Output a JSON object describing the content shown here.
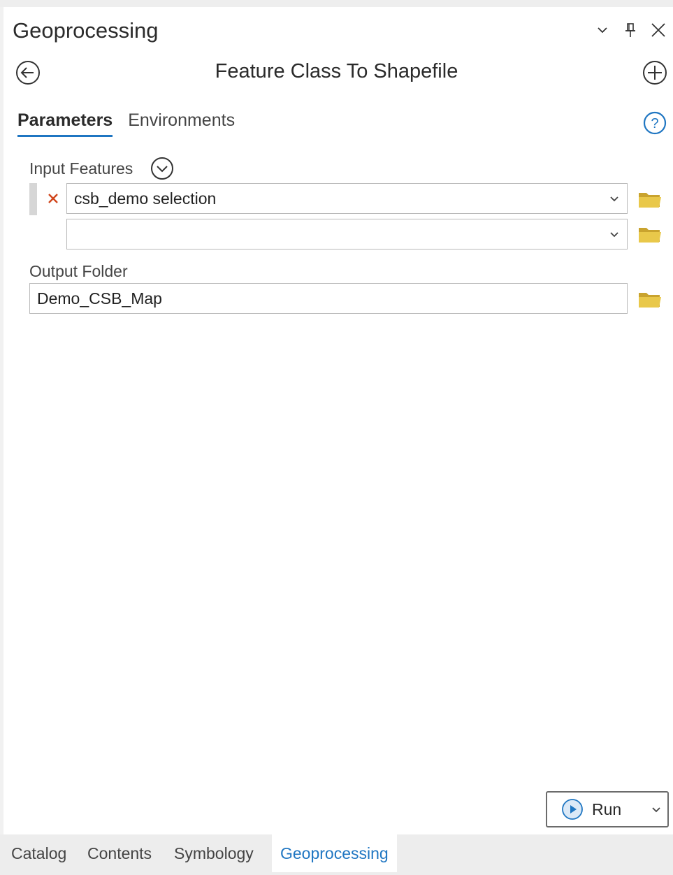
{
  "pane": {
    "title": "Geoprocessing",
    "controls": {
      "options_icon": "chevron-down-icon",
      "pin_icon": "pin-icon",
      "close_icon": "close-icon"
    }
  },
  "tool": {
    "title": "Feature Class To Shapefile",
    "back_icon": "back-arrow-icon",
    "add_icon": "plus-circle-icon"
  },
  "tabs": [
    {
      "label": "Parameters",
      "active": true
    },
    {
      "label": "Environments",
      "active": false
    }
  ],
  "help_icon": "help-icon",
  "params": {
    "input_features": {
      "label": "Input Features",
      "rows": [
        {
          "value": "csb_demo selection",
          "removable": true
        },
        {
          "value": "",
          "removable": false
        }
      ]
    },
    "output_folder": {
      "label": "Output Folder",
      "value": "Demo_CSB_Map"
    }
  },
  "run_button": {
    "label": "Run"
  },
  "bottom_tabs": [
    {
      "label": "Catalog",
      "active": false
    },
    {
      "label": "Contents",
      "active": false
    },
    {
      "label": "Symbology",
      "active": false
    },
    {
      "label": "Geoprocessing",
      "active": true
    }
  ],
  "colors": {
    "accent": "#1f76c2",
    "folder": "#e0bf3e",
    "remove": "#d0451b",
    "run_icon": "#1f76c2"
  }
}
